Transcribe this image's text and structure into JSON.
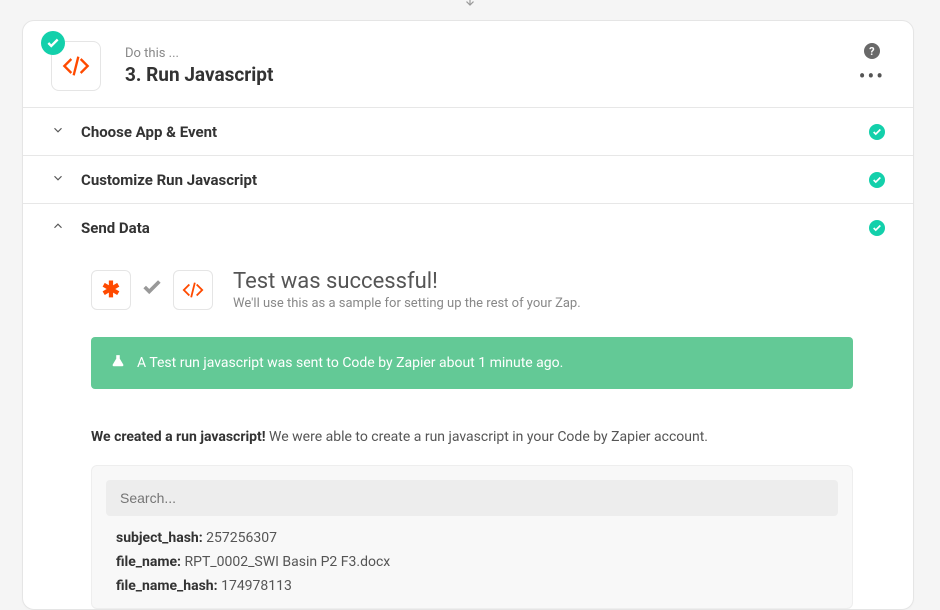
{
  "header": {
    "dothis": "Do this ...",
    "title": "3. Run Javascript"
  },
  "sections": {
    "choose": "Choose App & Event",
    "customize": "Customize Run Javascript",
    "send": "Send Data"
  },
  "test": {
    "title": "Test was successful!",
    "sub": "We'll use this as a sample for setting up the rest of your Zap."
  },
  "banner": "A Test run javascript was sent to Code by Zapier about 1 minute ago.",
  "created": {
    "strong": "We created a run javascript!",
    "rest": " We were able to create a run javascript in your Code by Zapier account."
  },
  "search": {
    "placeholder": "Search..."
  },
  "fields": [
    {
      "k": "subject_hash:",
      "v": " 257256307"
    },
    {
      "k": "file_name:",
      "v": " RPT_0002_SWI Basin P2 F3.docx"
    },
    {
      "k": "file_name_hash:",
      "v": " 174978113"
    }
  ]
}
